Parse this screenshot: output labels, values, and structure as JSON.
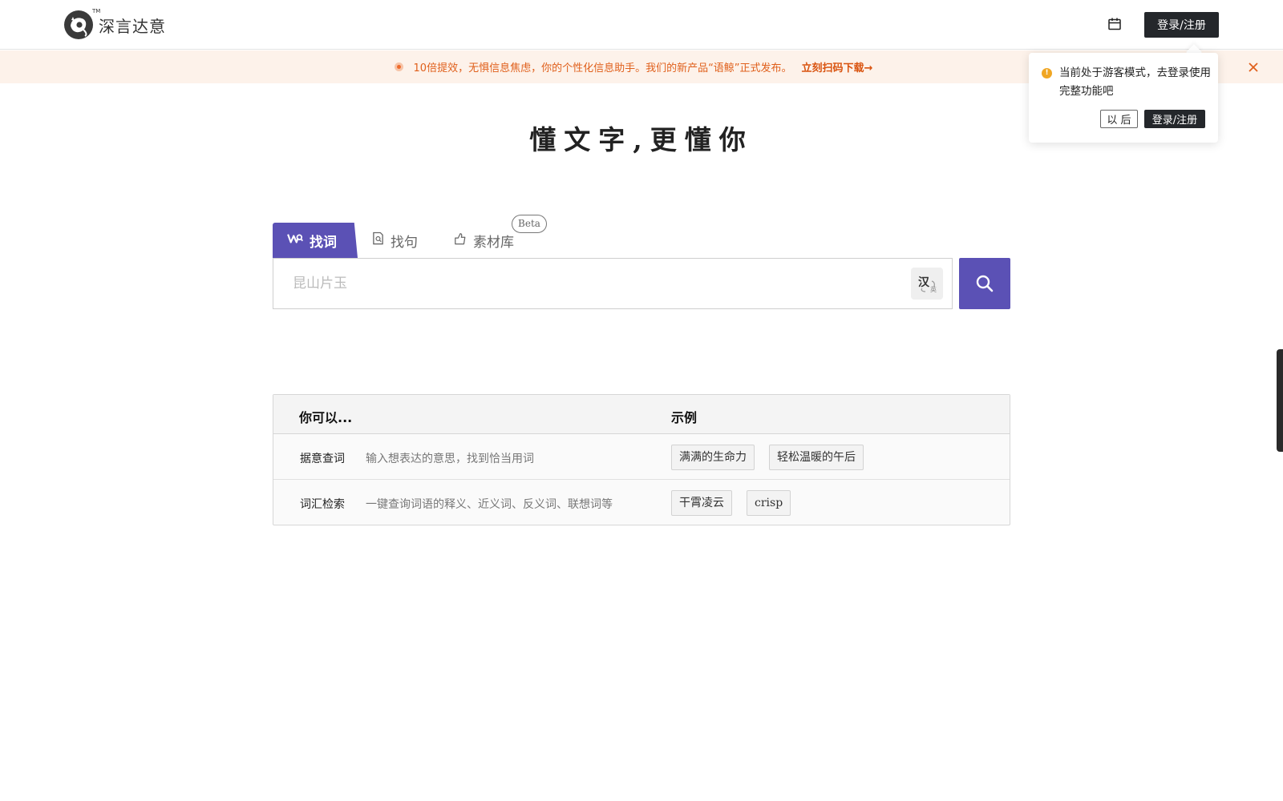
{
  "header": {
    "brand_name": "深言达意",
    "brand_tm": "TM",
    "login_label": "登录/注册"
  },
  "banner": {
    "message": "10倍提效，无惧信息焦虑，你的个性化信息助手。我们的新产品“语鲸”正式发布。",
    "link_label": "立刻扫码下载→"
  },
  "popover": {
    "message": "当前处于游客模式，去登录使用完整功能吧",
    "later_label": "以 后",
    "login_label": "登录/注册"
  },
  "hero": {
    "slogan": "懂文字,更懂你"
  },
  "tabs": [
    {
      "label": "找词",
      "icon": "word-search-icon",
      "active": true
    },
    {
      "label": "找句",
      "icon": "sentence-search-icon",
      "active": false
    },
    {
      "label": "素材库",
      "icon": "material-library-icon",
      "active": false,
      "badge": "Beta"
    }
  ],
  "search": {
    "placeholder": "昆山片玉",
    "lang_toggle_main": "汉",
    "lang_toggle_sub": "英"
  },
  "guide": {
    "col_you_can": "你可以...",
    "col_examples": "示例",
    "rows": [
      {
        "label": "据意查词",
        "desc": "输入想表达的意思，找到恰当用词",
        "examples": [
          "满满的生命力",
          "轻松温暖的午后"
        ]
      },
      {
        "label": "词汇检索",
        "desc": "一键查询词语的释义、近义词、反义词、联想词等",
        "examples": [
          "干霄凌云",
          "crisp"
        ]
      }
    ]
  },
  "colors": {
    "accent": "#5b51b5",
    "dark_button": "#24272b",
    "banner_bg": "#fdf2ea",
    "banner_text": "#e0601c",
    "warning": "#f0a623"
  }
}
